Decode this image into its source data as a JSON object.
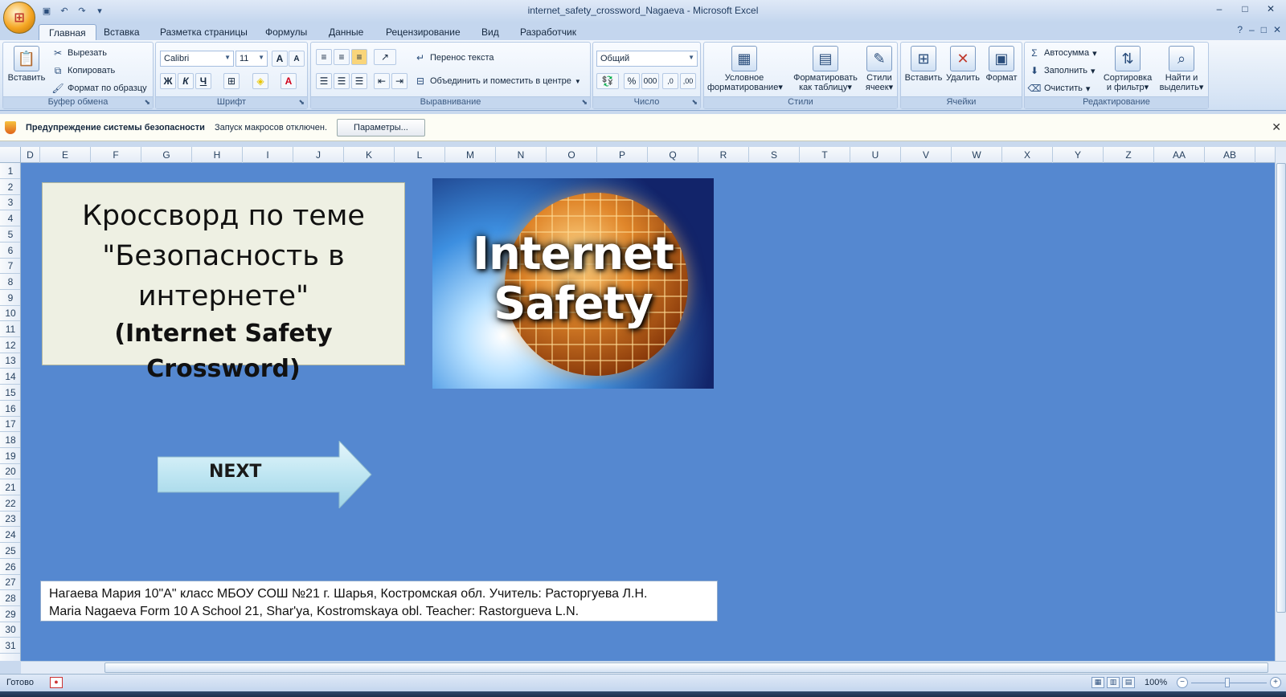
{
  "window": {
    "title": "internet_safety_crossword_Nagaeva - Microsoft Excel",
    "office_button": "⊞",
    "qat_icons": [
      "save-icon",
      "undo-icon",
      "redo-icon",
      "customize-icon"
    ],
    "controls": [
      "–",
      "□",
      "✕"
    ]
  },
  "ribbon_tabs": [
    {
      "label": "Главная",
      "active": true
    },
    {
      "label": "Вставка"
    },
    {
      "label": "Разметка страницы"
    },
    {
      "label": "Формулы"
    },
    {
      "label": "Данные"
    },
    {
      "label": "Рецензирование"
    },
    {
      "label": "Вид"
    },
    {
      "label": "Разработчик"
    }
  ],
  "ribbon": {
    "clipboard": {
      "label": "Буфер обмена",
      "paste": "Вставить",
      "cut": "Вырезать",
      "copy": "Копировать",
      "format_painter": "Формат по образцу"
    },
    "font": {
      "label": "Шрифт",
      "font_name": "Calibri",
      "font_size": "11",
      "bold": "Ж",
      "italic": "К",
      "underline": "Ч",
      "grow": "A",
      "shrink": "A",
      "font_color_glyph": "A"
    },
    "alignment": {
      "label": "Выравнивание",
      "wrap": "Перенос текста",
      "merge": "Объединить и поместить в центре"
    },
    "number": {
      "label": "Число",
      "format": "Общий",
      "percent": "%",
      "thousands": "000",
      "inc_decimal": ",0",
      "dec_decimal": ",00"
    },
    "styles": {
      "label": "Стили",
      "conditional": [
        "Условное",
        "форматирование"
      ],
      "as_table": [
        "Форматировать",
        "как таблицу"
      ],
      "cell_styles": [
        "Стили",
        "ячеек"
      ]
    },
    "cells": {
      "label": "Ячейки",
      "insert": "Вставить",
      "delete": "Удалить",
      "format": "Формат"
    },
    "editing": {
      "label": "Редактирование",
      "autosum": "Автосумма",
      "fill": "Заполнить",
      "clear": "Очистить",
      "sort": [
        "Сортировка",
        "и фильтр"
      ],
      "find": [
        "Найти и",
        "выделить"
      ]
    }
  },
  "security_bar": {
    "title": "Предупреждение системы безопасности",
    "message": "Запуск макросов отключен.",
    "button": "Параметры..."
  },
  "columns": [
    "D",
    "E",
    "F",
    "G",
    "H",
    "I",
    "J",
    "K",
    "L",
    "M",
    "N",
    "O",
    "P",
    "Q",
    "R",
    "S",
    "T",
    "U",
    "V",
    "W",
    "X",
    "Y",
    "Z",
    "AA",
    "AB"
  ],
  "rows": [
    "1",
    "2",
    "3",
    "4",
    "5",
    "6",
    "7",
    "8",
    "9",
    "10",
    "11",
    "12",
    "13",
    "14",
    "15",
    "16",
    "17",
    "18",
    "19",
    "20",
    "21",
    "22",
    "23",
    "24",
    "25",
    "26",
    "27",
    "28",
    "29",
    "30",
    "31"
  ],
  "sheet": {
    "title_ru_1": "Кроссворд по теме",
    "title_ru_2": "\"Безопасность в",
    "title_ru_3": "интернете\"",
    "title_en": "(Internet Safety Crossword)",
    "logo_line1": "Internet",
    "logo_line2": "Safety",
    "next_button": "NEXT",
    "credits_ru": "Нагаева Мария 10\"А\" класс МБОУ СОШ №21 г. Шарья, Костромская обл. Учитель: Расторгуева Л.Н.",
    "credits_en": "Maria Nagaeva Form 10 A School 21, Shar'ya, Kostromskaya obl. Teacher: Rastorgueva L.N."
  },
  "status": {
    "ready": "Готово",
    "zoom": "100%"
  },
  "colors": {
    "sheet_bg": "#5588d0",
    "title_box_bg": "#eef0e3",
    "next_arrow": "#bfe6f2"
  }
}
